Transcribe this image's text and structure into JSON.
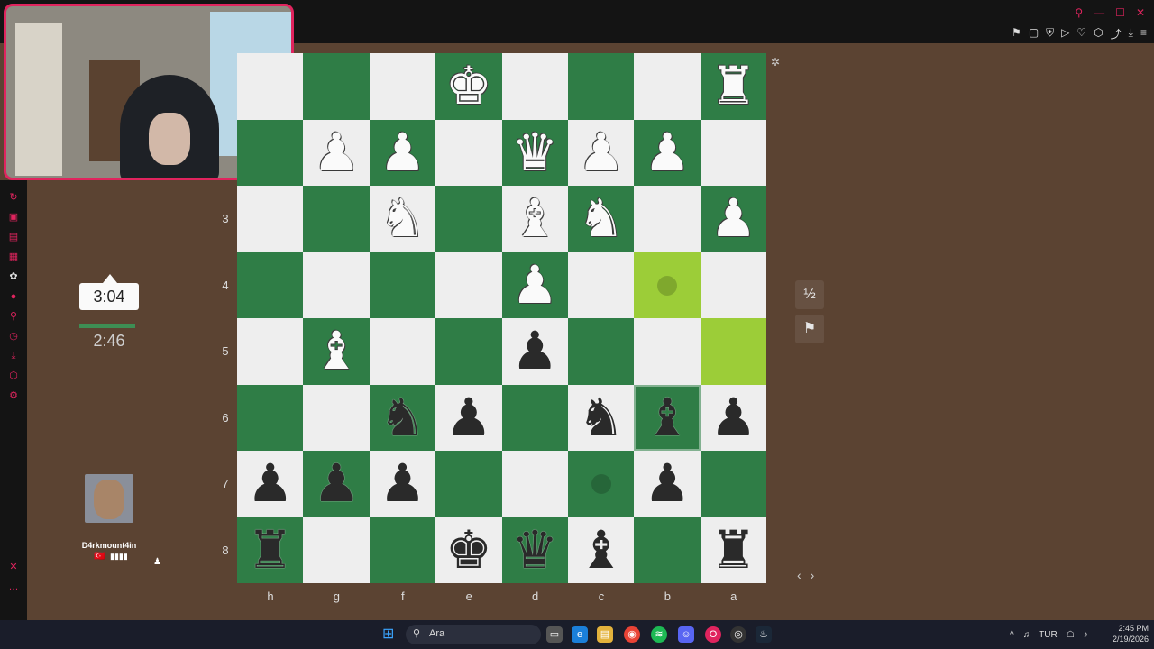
{
  "board": {
    "ranks": [
      "",
      "",
      "3",
      "4",
      "5",
      "6",
      "7",
      "8"
    ],
    "files": [
      "h",
      "g",
      "f",
      "e",
      "d",
      "c",
      "b",
      "a"
    ],
    "pieces": [
      {
        "row": 0,
        "col": 3,
        "glyph": "♚",
        "color": "w",
        "name": "white-king"
      },
      {
        "row": 0,
        "col": 7,
        "glyph": "♜",
        "color": "w",
        "name": "white-rook"
      },
      {
        "row": 1,
        "col": 1,
        "glyph": "♟",
        "color": "w",
        "name": "white-pawn"
      },
      {
        "row": 1,
        "col": 2,
        "glyph": "♟",
        "color": "w",
        "name": "white-pawn"
      },
      {
        "row": 1,
        "col": 4,
        "glyph": "♛",
        "color": "w",
        "name": "white-queen"
      },
      {
        "row": 1,
        "col": 5,
        "glyph": "♟",
        "color": "w",
        "name": "white-pawn"
      },
      {
        "row": 1,
        "col": 6,
        "glyph": "♟",
        "color": "w",
        "name": "white-pawn"
      },
      {
        "row": 2,
        "col": 2,
        "glyph": "♞",
        "color": "w",
        "name": "white-knight"
      },
      {
        "row": 2,
        "col": 4,
        "glyph": "♝",
        "color": "w",
        "name": "white-bishop"
      },
      {
        "row": 2,
        "col": 5,
        "glyph": "♞",
        "color": "w",
        "name": "white-knight"
      },
      {
        "row": 2,
        "col": 7,
        "glyph": "♟",
        "color": "w",
        "name": "white-pawn"
      },
      {
        "row": 3,
        "col": 4,
        "glyph": "♟",
        "color": "w",
        "name": "white-pawn"
      },
      {
        "row": 4,
        "col": 1,
        "glyph": "♝",
        "color": "w",
        "name": "white-bishop"
      },
      {
        "row": 4,
        "col": 4,
        "glyph": "♟",
        "color": "b",
        "name": "black-pawn"
      },
      {
        "row": 5,
        "col": 2,
        "glyph": "♞",
        "color": "b",
        "name": "black-knight"
      },
      {
        "row": 5,
        "col": 3,
        "glyph": "♟",
        "color": "b",
        "name": "black-pawn"
      },
      {
        "row": 5,
        "col": 5,
        "glyph": "♞",
        "color": "b",
        "name": "black-knight"
      },
      {
        "row": 5,
        "col": 6,
        "glyph": "♝",
        "color": "b",
        "name": "black-bishop"
      },
      {
        "row": 5,
        "col": 7,
        "glyph": "♟",
        "color": "b",
        "name": "black-pawn"
      },
      {
        "row": 6,
        "col": 0,
        "glyph": "♟",
        "color": "b",
        "name": "black-pawn"
      },
      {
        "row": 6,
        "col": 1,
        "glyph": "♟",
        "color": "b",
        "name": "black-pawn"
      },
      {
        "row": 6,
        "col": 2,
        "glyph": "♟",
        "color": "b",
        "name": "black-pawn"
      },
      {
        "row": 6,
        "col": 6,
        "glyph": "♟",
        "color": "b",
        "name": "black-pawn"
      },
      {
        "row": 7,
        "col": 0,
        "glyph": "♜",
        "color": "b",
        "name": "black-rook"
      },
      {
        "row": 7,
        "col": 3,
        "glyph": "♚",
        "color": "b",
        "name": "black-king"
      },
      {
        "row": 7,
        "col": 4,
        "glyph": "♛",
        "color": "b",
        "name": "black-queen"
      },
      {
        "row": 7,
        "col": 5,
        "glyph": "♝",
        "color": "b",
        "name": "black-bishop"
      },
      {
        "row": 7,
        "col": 7,
        "glyph": "♜",
        "color": "b",
        "name": "black-rook"
      }
    ],
    "highlights": [
      {
        "row": 3,
        "col": 6
      },
      {
        "row": 4,
        "col": 7
      }
    ],
    "selected": {
      "row": 5,
      "col": 6
    },
    "move_dots": [
      {
        "row": 3,
        "col": 6
      },
      {
        "row": 6,
        "col": 5
      }
    ],
    "colors": {
      "light": "#eeeeee",
      "dark": "#2f7d46",
      "highlight": "#9ccd38"
    }
  },
  "clocks": {
    "top": "3:04",
    "bottom": "2:46"
  },
  "player": {
    "name": "D4rkmount4in",
    "flag": "🇹🇷",
    "rating": "▮▮▮▮"
  },
  "controls": {
    "draw_label": "½",
    "resign_icon": "flag-icon"
  },
  "taskbar": {
    "search_placeholder": "Ara",
    "lang": "TUR",
    "time": "2:45 PM",
    "date": "2/19/2026"
  }
}
